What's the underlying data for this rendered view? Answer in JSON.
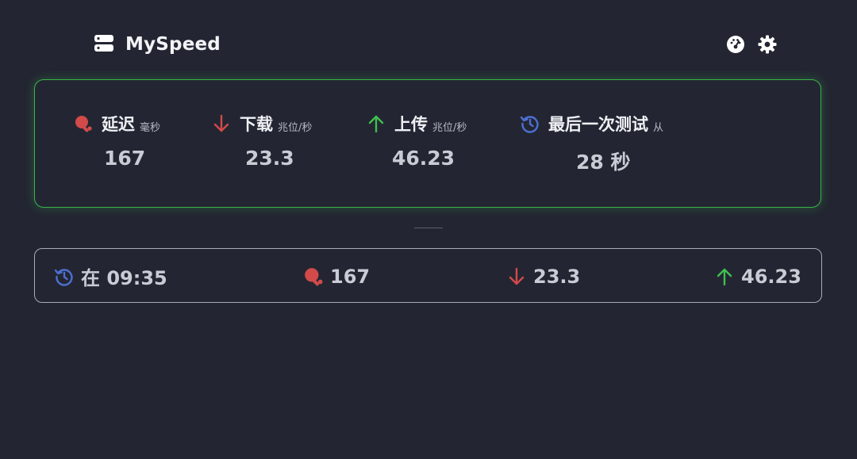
{
  "app": {
    "title": "MySpeed",
    "icons": {
      "brand": "server-icon",
      "speedometer": "speedometer-icon",
      "settings": "gear-icon"
    }
  },
  "stats": {
    "ping": {
      "label": "延迟",
      "unit": "毫秒",
      "value": "167",
      "icon": "ping-pong-icon",
      "color": "#d24a4a"
    },
    "download": {
      "label": "下载",
      "unit": "兆位/秒",
      "value": "23.3",
      "icon": "arrow-down-icon",
      "color": "#d24a4a"
    },
    "upload": {
      "label": "上传",
      "unit": "兆位/秒",
      "value": "46.23",
      "icon": "arrow-up-icon",
      "color": "#3fbf4f"
    },
    "last_test": {
      "label": "最后一次测试",
      "unit": "从",
      "value": "28 秒",
      "icon": "history-icon",
      "color": "#4d6fd1"
    }
  },
  "history": [
    {
      "time_text": "在 09:35",
      "ping": "167",
      "download": "23.3",
      "upload": "46.23"
    }
  ],
  "colors": {
    "background": "#232632",
    "accent_green": "#39b54a",
    "red": "#d24a4a",
    "blue": "#4d6fd1"
  }
}
